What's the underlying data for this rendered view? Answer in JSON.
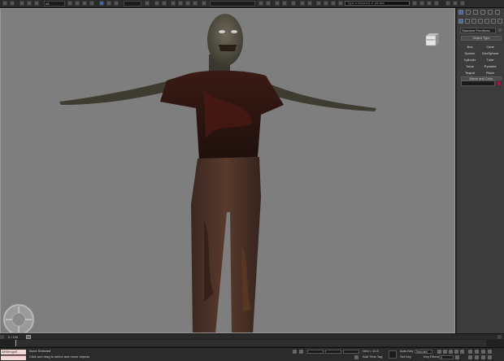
{
  "app": {
    "search_placeholder": "Type a keyword or phrase",
    "selection_filter": "All"
  },
  "viewport": {
    "viewcube_label": "FRONT",
    "background_color": "#7e7e7e"
  },
  "command_panel": {
    "category_dropdown": "Standard Primitives",
    "object_type_header": "Object Type",
    "object_buttons": [
      "Box",
      "Cone",
      "Sphere",
      "GeoSphere",
      "Cylinder",
      "Tube",
      "Torus",
      "Pyramid",
      "Teapot",
      "Plane"
    ],
    "name_color_header": "Name and Color",
    "object_color": "#b0103a"
  },
  "timeline": {
    "frame_counter": "0 / 100"
  },
  "status": {
    "maxscript_label": "AllStringsE...",
    "selection_status": "None Selected",
    "prompt": "Click and drag to select and move objects",
    "grid_value": "Grid = 10.0",
    "add_time_tag": "Add Time Tag",
    "auto_key": "Auto Key",
    "set_key": "Set Key",
    "key_mode_value": "Selected",
    "key_filters": "Key Filters...",
    "frame_value": "0"
  }
}
